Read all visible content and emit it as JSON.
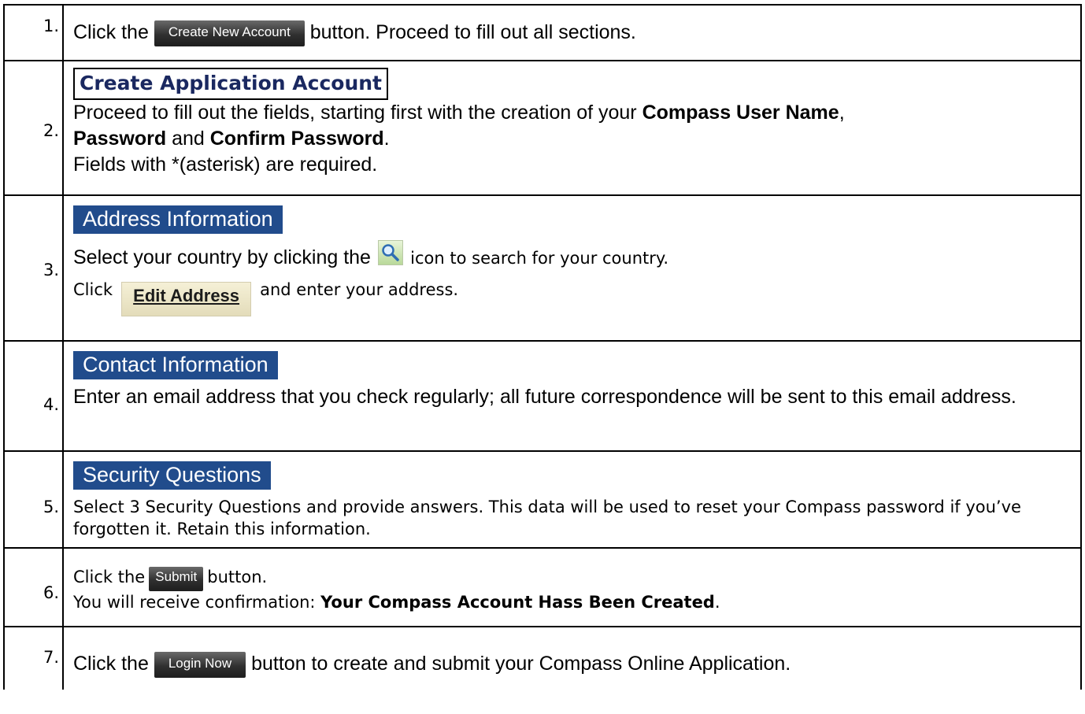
{
  "steps": [
    {
      "num": "1.",
      "pre": "Click the",
      "button": "Create New Account",
      "post": "button. Proceed to fill out all sections."
    },
    {
      "num": "2.",
      "header": "Create Application Account",
      "line1_pre": "Proceed to fill out the fields, starting first with the creation of your",
      "line1_bold": "Compass User Name",
      "line1_post": ",",
      "line2_bold1": "Password",
      "line2_mid": "and",
      "line2_bold2": "Confirm Password",
      "line2_post": ".",
      "line3": "Fields with *(asterisk) are required."
    },
    {
      "num": "3.",
      "header": "Address Information",
      "line1_pre": "Select your country by clicking the",
      "line1_post": "icon to search for your country.",
      "line2_pre": "Click",
      "button": "Edit Address",
      "line2_post": "and enter your address."
    },
    {
      "num": "4.",
      "header": "Contact Information",
      "text": "Enter an email address that you check regularly; all future correspondence will be sent to this email address."
    },
    {
      "num": "5.",
      "header": "Security Questions",
      "text": "Select 3 Security Questions and provide answers. This data will be used to reset your Compass password if you’ve forgotten it. Retain this information."
    },
    {
      "num": "6.",
      "pre": "Click the",
      "button": "Submit",
      "post": "button.",
      "line2_pre": "You will receive confirmation:",
      "line2_bold": "Your Compass Account Hass Been Created",
      "line2_post": "."
    },
    {
      "num": "7.",
      "pre": "Click the",
      "button": "Login Now",
      "post": "button to create and submit your Compass Online Application."
    }
  ],
  "icons": {
    "search": "magnifier-icon"
  }
}
